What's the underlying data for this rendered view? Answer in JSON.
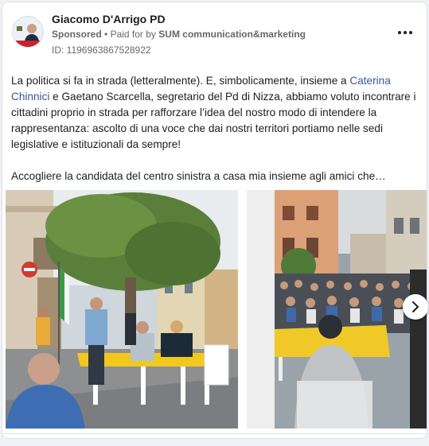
{
  "post": {
    "page_name": "Giacomo D'Arrigo PD",
    "sponsored_label": "Sponsored",
    "separator": "•",
    "paid_for_prefix": "Paid for by",
    "payer": "SUM communication&marketing",
    "library_id": "ID: 1196963867528922"
  },
  "body": {
    "t1": "La politica si fa in strada (letteralmente). E, simbolicamente, insieme a ",
    "link1": "Caterina Chinnici",
    "t2": " e Gaetano Scarcella, segretario del Pd di Nizza, abbiamo voluto incontrare i cittadini proprio in strada per rafforzare l’idea del nostro modo di intendere la rappresentanza: ascolto di una voce che dai nostri territori portiamo nelle sedi legislative e istituzionali da sempre!",
    "t3": "Accogliere la candidata del centro sinistra a casa mia insieme agli amici che…"
  },
  "icons": {
    "more": "more-horizontal-icon",
    "next": "chevron-right-icon"
  },
  "colors": {
    "link": "#385898",
    "meta": "#65676b",
    "text": "#1c1e21"
  }
}
